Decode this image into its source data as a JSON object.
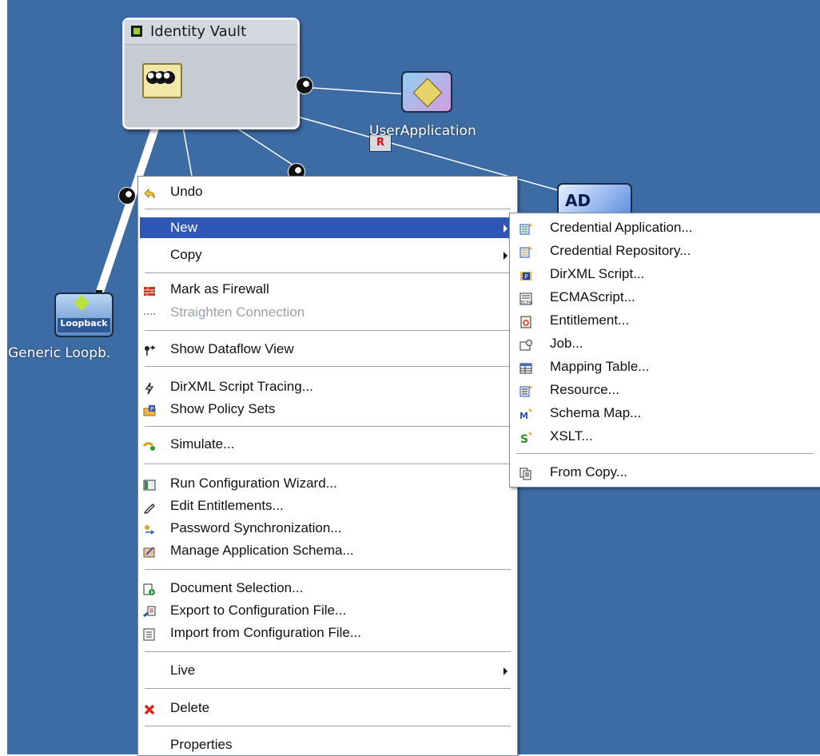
{
  "diagram": {
    "vault_title": "Identity Vault",
    "nodes": {
      "user_application": "UserApplication",
      "loopback_badge": "Loopback",
      "generic_loopback": "Generic Loopb.",
      "ad_badge": "AD"
    },
    "colors": {
      "canvas": "#3d6ba3",
      "wire": "#ffffff"
    }
  },
  "context_menu": {
    "undo": {
      "label": "Undo",
      "icon": "undo-arrow-icon"
    },
    "new": {
      "label": "New",
      "icon": "none"
    },
    "copy": {
      "label": "Copy",
      "icon": "none"
    },
    "mark_firewall": {
      "label": "Mark as Firewall",
      "icon": "brick-wall-icon"
    },
    "straighten": {
      "label": "Straighten Connection",
      "icon": "dotted-line-icon"
    },
    "dataflow": {
      "label": "Show Dataflow View",
      "icon": "dataflow-icon"
    },
    "script_tracing": {
      "label": "DirXML Script Tracing...",
      "icon": "lightning-icon"
    },
    "policy_sets": {
      "label": "Show Policy Sets",
      "icon": "policy-folder-icon"
    },
    "simulate": {
      "label": "Simulate...",
      "icon": "simulate-icon"
    },
    "config_wizard": {
      "label": "Run Configuration Wizard...",
      "icon": "wizard-icon"
    },
    "edit_entitlements": {
      "label": "Edit Entitlements...",
      "icon": "pencil-icon"
    },
    "password_sync": {
      "label": "Password Synchronization...",
      "icon": "password-sync-icon"
    },
    "app_schema": {
      "label": "Manage Application Schema...",
      "icon": "schema-icon"
    },
    "doc_selection": {
      "label": "Document Selection...",
      "icon": "document-play-icon"
    },
    "export_config": {
      "label": "Export to Configuration File...",
      "icon": "export-icon"
    },
    "import_config": {
      "label": "Import from Configuration File...",
      "icon": "import-icon"
    },
    "live": {
      "label": "Live",
      "icon": "none"
    },
    "delete": {
      "label": "Delete",
      "icon": "red-x-icon"
    },
    "properties": {
      "label": "Properties",
      "icon": "none"
    },
    "selected_item": "New"
  },
  "new_submenu": {
    "credential_application": "Credential Application...",
    "credential_repository": "Credential Repository...",
    "dirxml_script": "DirXML Script...",
    "ecmascript": "ECMAScript...",
    "entitlement": "Entitlement...",
    "job": "Job...",
    "mapping_table": "Mapping Table...",
    "resource": "Resource...",
    "schema_map": "Schema Map...",
    "xslt": "XSLT...",
    "from_copy": "From Copy..."
  },
  "accent_colors": {
    "selection": "#2f58b6",
    "menu_border": "#7f8c9e"
  }
}
